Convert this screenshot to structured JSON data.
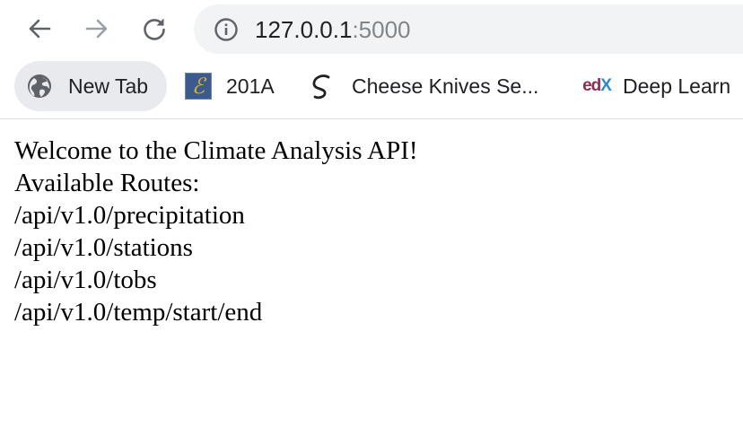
{
  "toolbar": {
    "url_host": "127.0.0.1",
    "url_port": ":5000",
    "icons": {
      "back": "back-arrow-icon",
      "forward": "forward-arrow-icon",
      "reload": "reload-icon",
      "site_info": "info-icon"
    }
  },
  "bookmarks": [
    {
      "label": "New Tab",
      "icon": "globe-icon"
    },
    {
      "label": "201A",
      "icon": "script-e-icon",
      "icon_glyph": "ℰ"
    },
    {
      "label": "Cheese Knives Se...",
      "icon": "swirl-icon"
    },
    {
      "label": "Deep Learn",
      "icon": "edx-icon",
      "icon_text_ed": "ed",
      "icon_text_x": "X"
    }
  ],
  "page": {
    "welcome": "Welcome to the Climate Analysis API!",
    "routes_heading": "Available Routes:",
    "routes": [
      "/api/v1.0/precipitation",
      "/api/v1.0/stations",
      "/api/v1.0/tobs",
      "/api/v1.0/temp/start/end"
    ]
  },
  "colors": {
    "omnibox_bg": "#f1f3f4",
    "chip_bg": "#e8eaed",
    "icon_gray": "#5f6368",
    "icon_disabled": "#9aa0a6",
    "url_dim": "#80868b"
  }
}
